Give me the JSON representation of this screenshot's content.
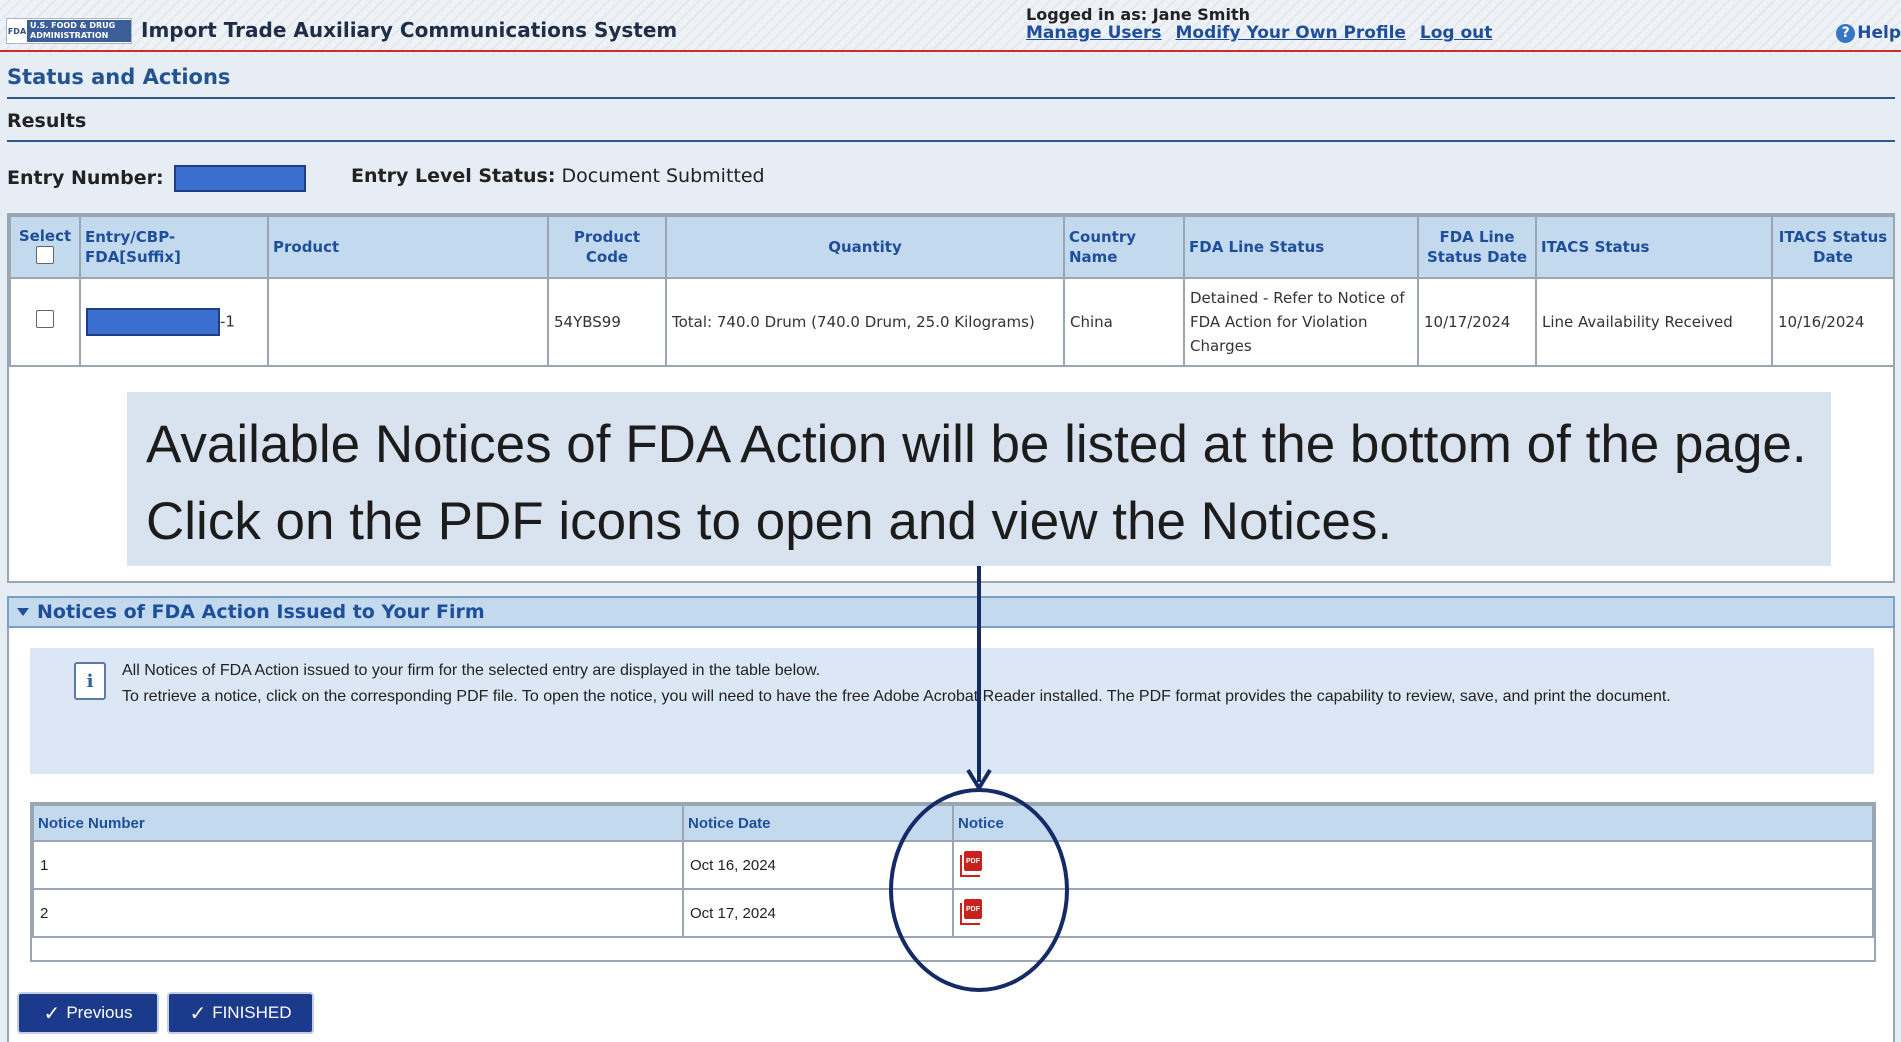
{
  "header": {
    "logo_mark": "FDA",
    "logo_text": "U.S. FOOD & DRUG ADMINISTRATION",
    "app_title": "Import Trade Auxiliary Communications System",
    "logged_in": "Logged in as: Jane Smith",
    "links": [
      "Manage Users",
      "Modify Your Own Profile",
      "Log out"
    ],
    "help": "Help"
  },
  "page": {
    "section_title": "Status and Actions",
    "results_title": "Results",
    "entry_number_label": "Entry Number:",
    "entry_level_status_label": "Entry Level Status:",
    "entry_level_status_value": "Document Submitted"
  },
  "results_table": {
    "headers": [
      "Select",
      "Entry/CBP-FDA[Suffix]",
      "Product",
      "Product Code",
      "Quantity",
      "Country Name",
      "FDA Line Status",
      "FDA Line Status Date",
      "ITACS Status",
      "ITACS Status Date"
    ],
    "rows": [
      {
        "suffix": "-1",
        "product": "",
        "product_code": "54YBS99",
        "quantity": "Total: 740.0 Drum (740.0 Drum, 25.0 Kilograms)",
        "country": "China",
        "fda_line_status": "Detained - Refer to Notice of FDA Action for Violation Charges",
        "fda_line_status_date": "10/17/2024",
        "itacs_status": "Line Availability Received",
        "itacs_status_date": "10/16/2024"
      }
    ]
  },
  "callout": {
    "text": "Available Notices of FDA Action will be listed at the bottom of the page.  Click on the PDF icons to open and view the Notices."
  },
  "notices": {
    "title": "Notices of FDA Action Issued to Your Firm",
    "info_line1": "All Notices of FDA Action issued to your firm for the selected entry are displayed in the table below.",
    "info_line2": "To retrieve a notice, click on the corresponding PDF file. To open the notice, you will need to have the free Adobe Acrobat Reader installed. The PDF format provides the capability to review, save, and print the document.",
    "headers": [
      "Notice Number",
      "Notice Date",
      "Notice"
    ],
    "rows": [
      {
        "number": "1",
        "date": "Oct 16, 2024",
        "icon": "pdf-icon"
      },
      {
        "number": "2",
        "date": "Oct 17, 2024",
        "icon": "pdf-icon"
      }
    ]
  },
  "buttons": {
    "previous": "Previous",
    "finished": "FINISHED"
  },
  "colors": {
    "header_border": "#c9302c",
    "table_header_bg": "#c2d9ee",
    "link": "#1f4f9a",
    "button_bg": "#1b3a8c",
    "annotation": "#152a66",
    "redaction": "#3b6fcf"
  }
}
